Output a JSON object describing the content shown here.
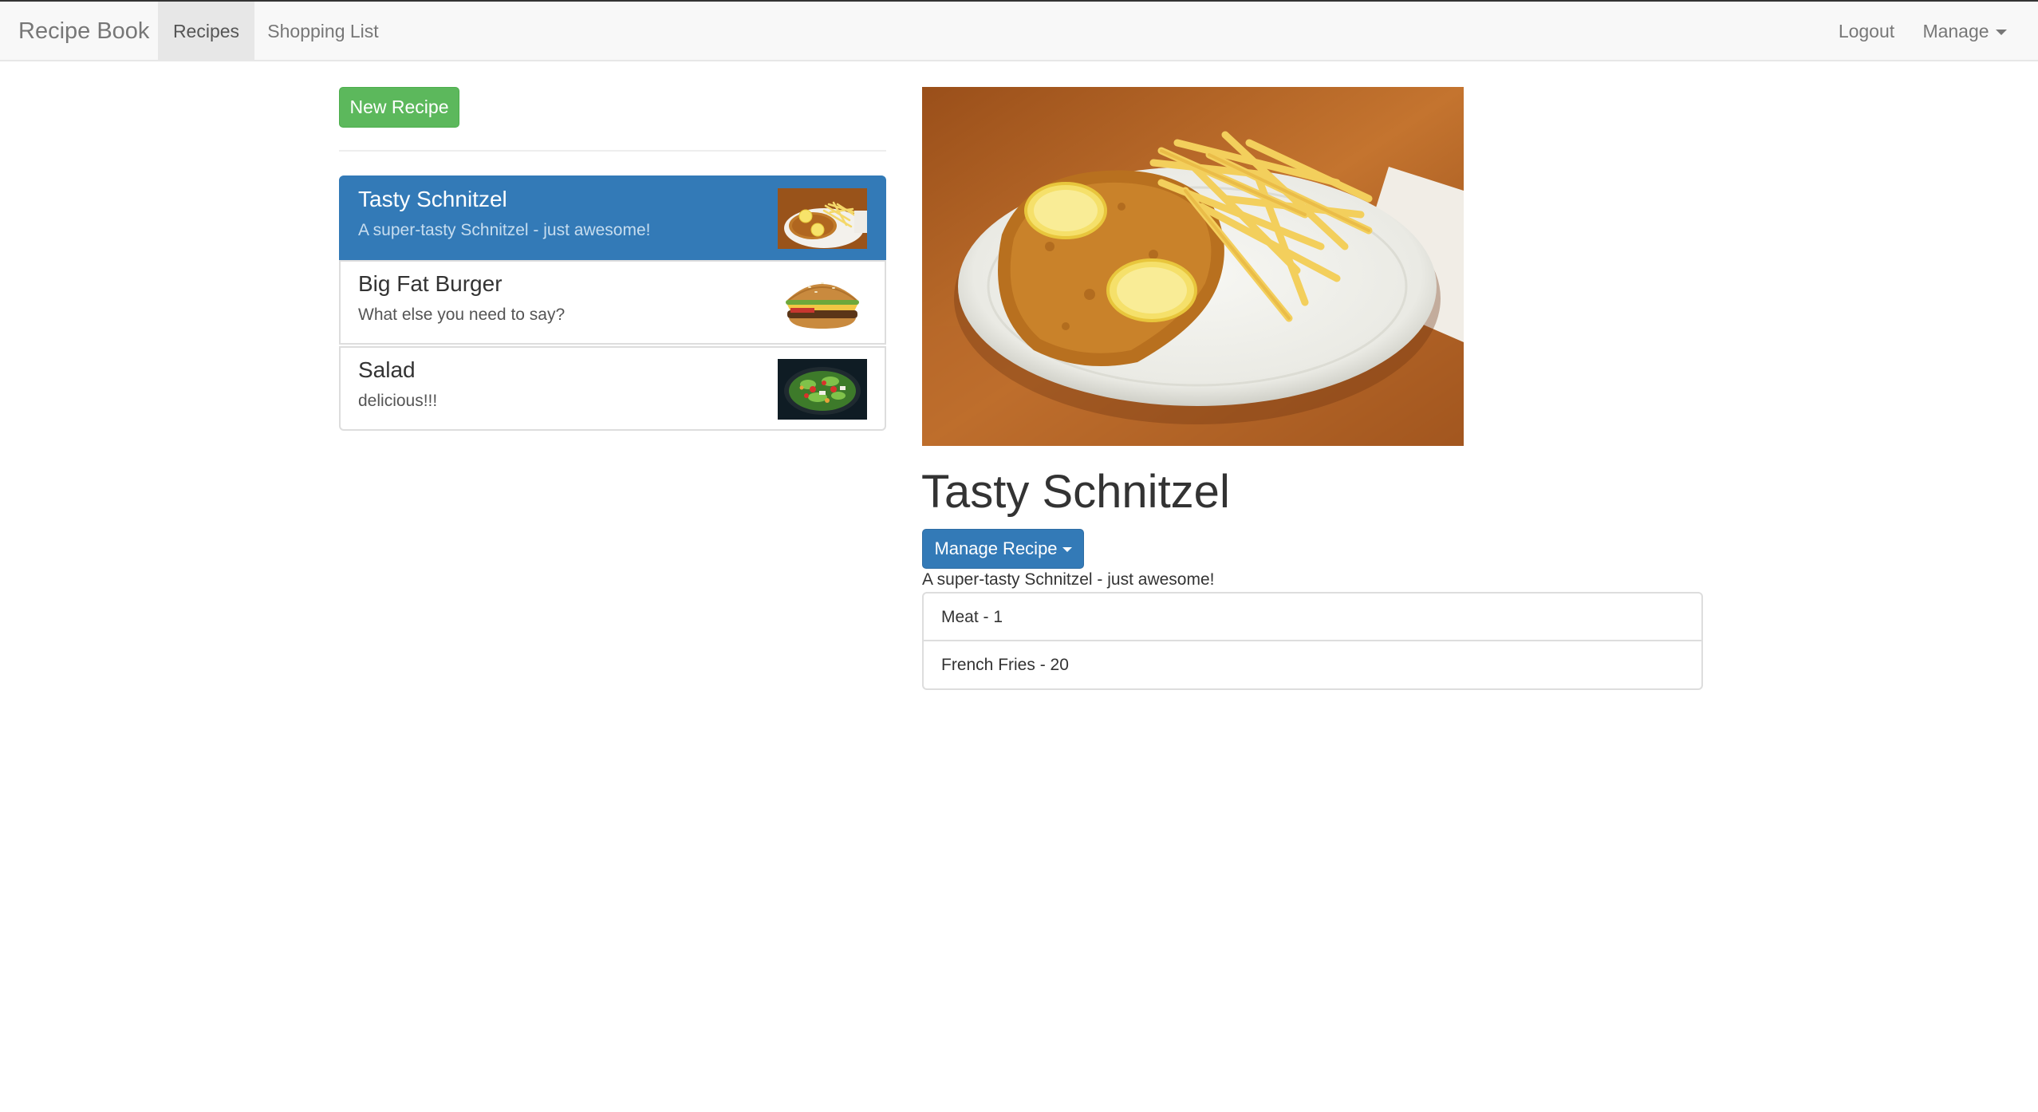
{
  "navbar": {
    "brand": "Recipe Book",
    "links": [
      "Recipes",
      "Shopping List"
    ],
    "active_link": "Recipes",
    "logout": "Logout",
    "manage": "Manage"
  },
  "sidebar": {
    "new_recipe_label": "New Recipe",
    "recipes": [
      {
        "name": "Tasty Schnitzel",
        "description": "A super-tasty Schnitzel - just awesome!",
        "image": "schnitzel-photo",
        "active": true
      },
      {
        "name": "Big Fat Burger",
        "description": "What else you need to say?",
        "image": "burger-photo",
        "active": false
      },
      {
        "name": "Salad",
        "description": "delicious!!!",
        "image": "salad-photo",
        "active": false
      }
    ]
  },
  "detail": {
    "image": "schnitzel-photo",
    "title": "Tasty Schnitzel",
    "manage_label": "Manage Recipe",
    "description": "A super-tasty Schnitzel - just awesome!",
    "ingredients": [
      "Meat - 1",
      "French Fries - 20"
    ]
  },
  "colors": {
    "primary": "#337ab7",
    "success": "#5cb85c",
    "navbar_bg": "#f8f8f8",
    "active_nav_bg": "#e7e7e7"
  }
}
